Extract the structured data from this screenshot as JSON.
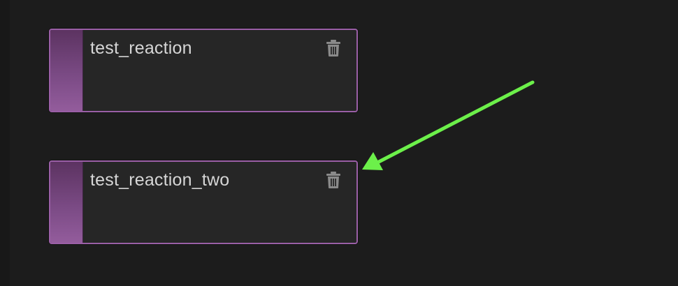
{
  "nodes": [
    {
      "title": "test_reaction",
      "action_icon": "trash-icon"
    },
    {
      "title": "test_reaction_two",
      "action_icon": "trash-icon"
    }
  ],
  "colors": {
    "background": "#1c1c1c",
    "node_border": "#9a5fa6",
    "node_stripe": "#7a4a84",
    "node_body": "#262626",
    "title_text": "#d6d6d6",
    "icon": "#8a8a8a",
    "annotation_arrow": "#6cf04a"
  }
}
